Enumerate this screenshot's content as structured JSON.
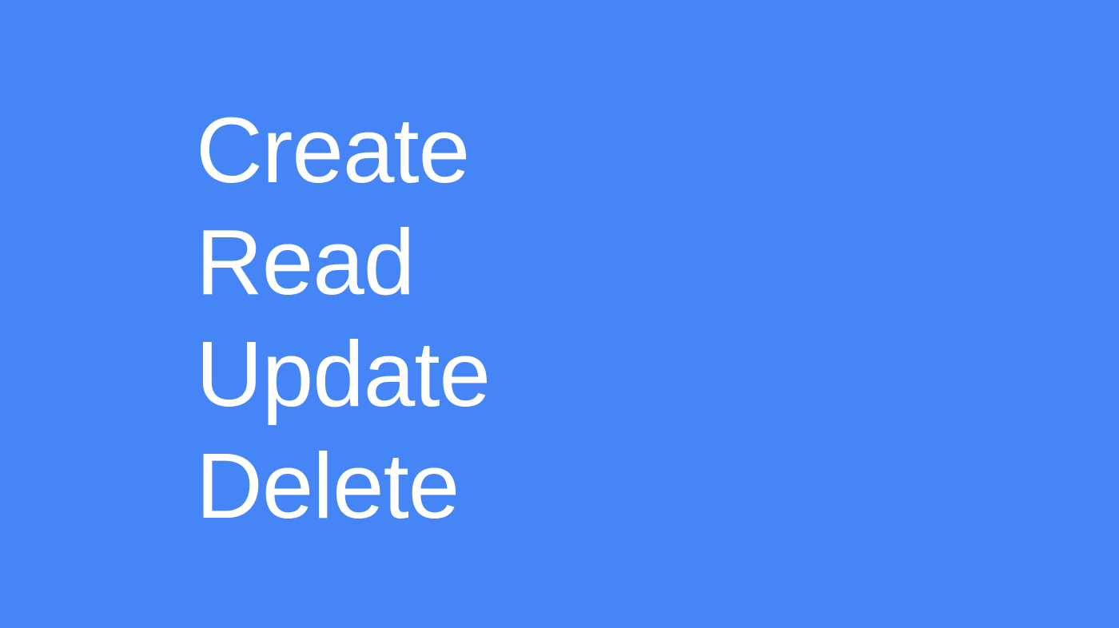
{
  "colors": {
    "background": "#4585f5",
    "text": "#ffffff"
  },
  "words": [
    "Create",
    "Read",
    "Update",
    "Delete"
  ]
}
